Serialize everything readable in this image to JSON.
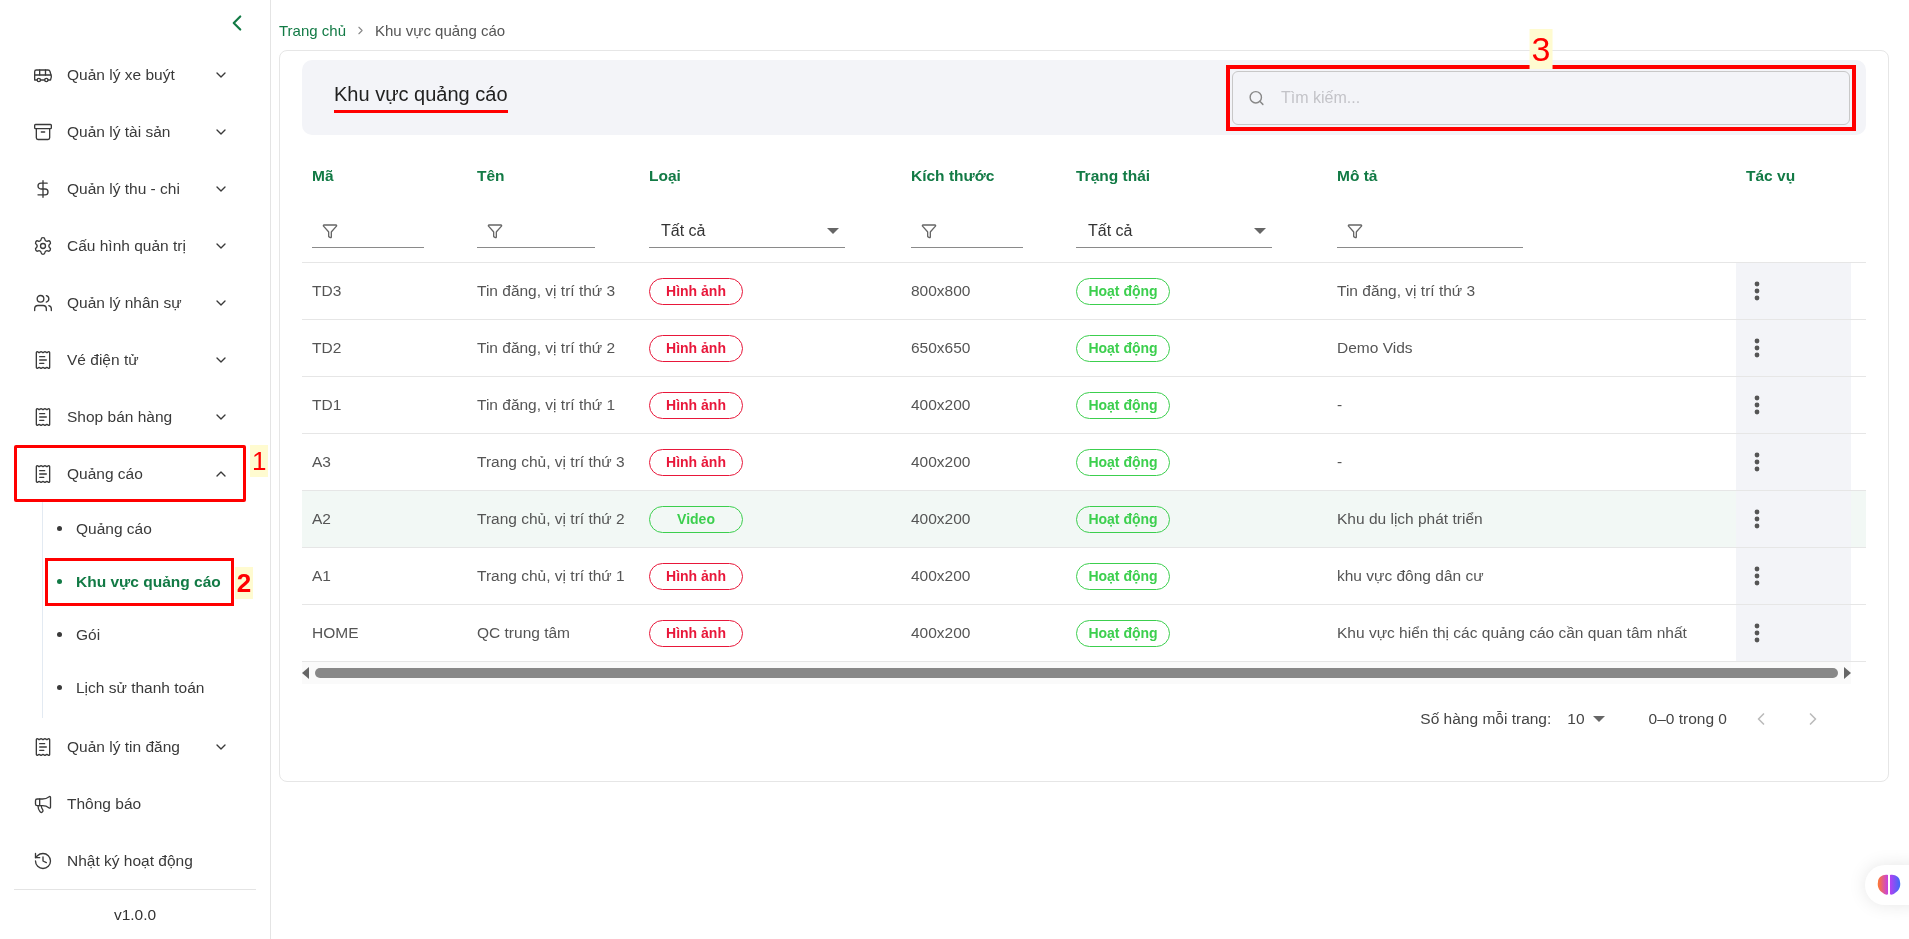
{
  "sidebar": {
    "items": [
      {
        "label": "Quản lý xe buýt",
        "expanded": false
      },
      {
        "label": "Quản lý tài sản",
        "expanded": false
      },
      {
        "label": "Quản lý thu - chi",
        "expanded": false
      },
      {
        "label": "Cấu hình quản trị",
        "expanded": false
      },
      {
        "label": "Quản lý nhân sự",
        "expanded": false
      },
      {
        "label": "Vé điện tử",
        "expanded": false
      },
      {
        "label": "Shop bán hàng",
        "expanded": false
      },
      {
        "label": "Quảng cáo",
        "expanded": true,
        "annotation": {
          "label": "1"
        },
        "children": [
          {
            "label": "Quảng cáo",
            "selected": false
          },
          {
            "label": "Khu vực quảng cáo",
            "selected": true,
            "annotation": {
              "label": "2"
            }
          },
          {
            "label": "Gói",
            "selected": false
          },
          {
            "label": "Lịch sử thanh toán",
            "selected": false
          }
        ]
      },
      {
        "label": "Quản lý tin đăng",
        "expanded": false
      },
      {
        "label": "Thông báo"
      },
      {
        "label": "Nhật ký hoạt động"
      }
    ],
    "version": "v1.0.0"
  },
  "breadcrumb": [
    {
      "label": "Trang chủ",
      "selected": false
    },
    {
      "label": "Khu vực quảng cáo",
      "selected": true
    }
  ],
  "page_title": {
    "text": "Khu vực quảng cáo",
    "underlined": true
  },
  "search": {
    "placeholder": "Tìm kiếm...",
    "annotation": {
      "label": "3"
    }
  },
  "table": {
    "columns": [
      {
        "label": "Mã",
        "filter": {
          "kind": "text"
        }
      },
      {
        "label": "Tên",
        "filter": {
          "kind": "text"
        }
      },
      {
        "label": "Loại",
        "filter": {
          "kind": "select",
          "value": "Tất cả"
        }
      },
      {
        "label": "Kích thước",
        "filter": {
          "kind": "text"
        }
      },
      {
        "label": "Trạng thái",
        "filter": {
          "kind": "select",
          "value": "Tất cả"
        }
      },
      {
        "label": "Mô tả",
        "filter": {
          "kind": "text"
        }
      },
      {
        "label": "Tác vụ"
      }
    ],
    "rows": [
      {
        "code": "TD3",
        "name": "Tin đăng, vị trí thứ 3",
        "type": {
          "label": "Hình ảnh",
          "color": "#e8173a"
        },
        "size": "800x800",
        "status": {
          "label": "Hoạt động",
          "color": "#3ccf4e"
        },
        "description": "Tin đăng, vị trí thứ 3",
        "selected": false
      },
      {
        "code": "TD2",
        "name": "Tin đăng, vị trí thứ 2",
        "type": {
          "label": "Hình ảnh",
          "color": "#e8173a"
        },
        "size": "650x650",
        "status": {
          "label": "Hoạt động",
          "color": "#3ccf4e"
        },
        "description": "Demo Vids",
        "selected": false
      },
      {
        "code": "TD1",
        "name": "Tin đăng, vị trí thứ 1",
        "type": {
          "label": "Hình ảnh",
          "color": "#e8173a"
        },
        "size": "400x200",
        "status": {
          "label": "Hoạt động",
          "color": "#3ccf4e"
        },
        "description": "-",
        "selected": false
      },
      {
        "code": "A3",
        "name": "Trang chủ, vị trí thứ 3",
        "type": {
          "label": "Hình ảnh",
          "color": "#e8173a"
        },
        "size": "400x200",
        "status": {
          "label": "Hoạt động",
          "color": "#3ccf4e"
        },
        "description": "-",
        "selected": false
      },
      {
        "code": "A2",
        "name": "Trang chủ, vị trí thứ 2",
        "type": {
          "label": "Video",
          "color": "#3ccf4e"
        },
        "size": "400x200",
        "status": {
          "label": "Hoạt động",
          "color": "#3ccf4e"
        },
        "description": "Khu du lịch phát triển",
        "selected": true
      },
      {
        "code": "A1",
        "name": "Trang chủ, vị trí thứ 1",
        "type": {
          "label": "Hình ảnh",
          "color": "#e8173a"
        },
        "size": "400x200",
        "status": {
          "label": "Hoạt động",
          "color": "#3ccf4e"
        },
        "description": "khu vực đông dân cư",
        "selected": false
      },
      {
        "code": "HOME",
        "name": "QC trung tâm",
        "type": {
          "label": "Hình ảnh",
          "color": "#e8173a"
        },
        "size": "400x200",
        "status": {
          "label": "Hoạt động",
          "color": "#3ccf4e"
        },
        "description": "Khu vực hiển thị các quảng cáo cần quan tâm nhất",
        "selected": false
      }
    ]
  },
  "pagination": {
    "rows_per_page_label": "Số hàng mỗi trang:",
    "rows_per_page": "10",
    "range": "0–0 trong 0"
  }
}
